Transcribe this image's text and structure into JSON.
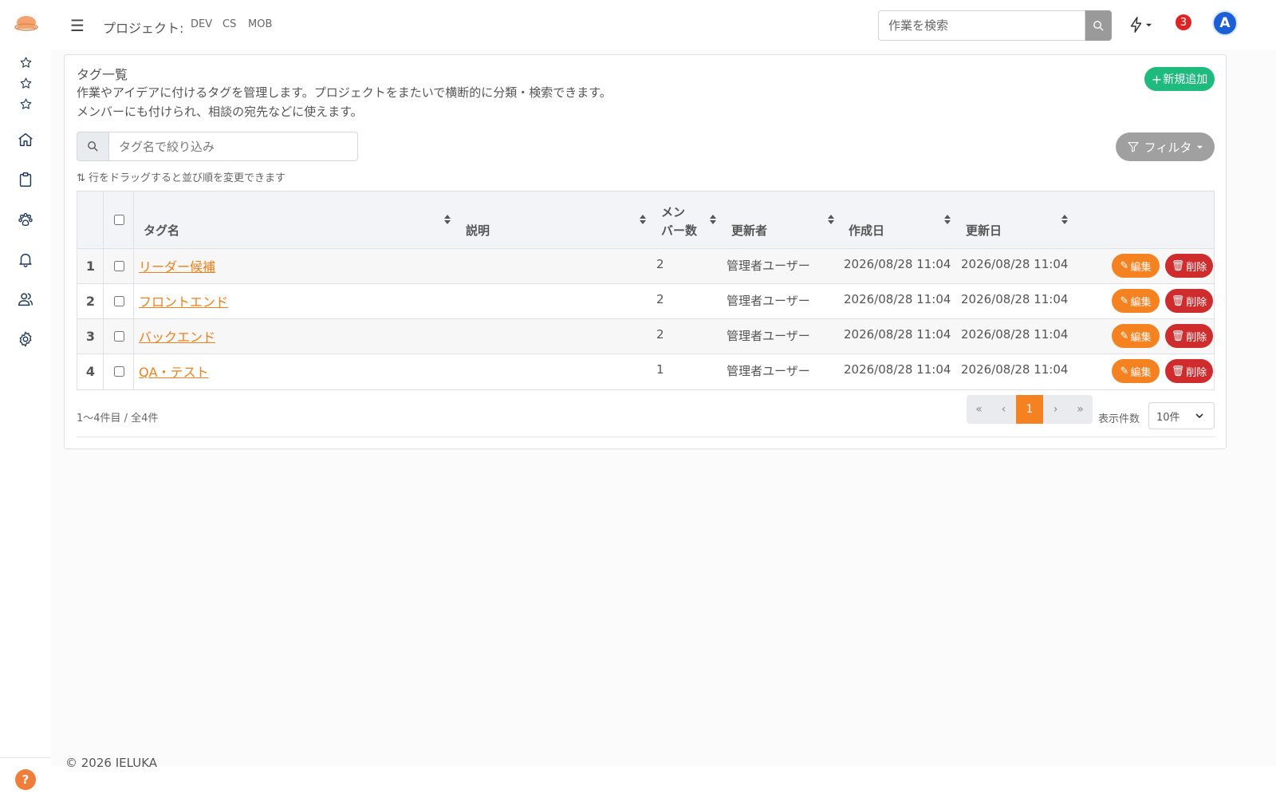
{
  "topbar": {
    "menu_icon": "☰",
    "project_label": "プロジェクト:",
    "projects": [
      "DEV",
      "CS",
      "MOB"
    ],
    "search_placeholder": "作業を検索",
    "notification_count": "3",
    "avatar_initial": "A"
  },
  "page": {
    "title": "タグ一覧",
    "description_lines": [
      "作業やアイデアに付けるタグを管理します。プロジェクトをまたいで横断的に分類・検索できます。",
      "メンバーにも付けられ、相談の宛先などに使えます。"
    ],
    "new_button_label": "新規追加",
    "filter_placeholder": "タグ名で絞り込み",
    "filter_button_label": "フィルタ",
    "drag_hint": "行をドラッグすると並び順を変更できます"
  },
  "table": {
    "headers": {
      "tag_name": "タグ名",
      "description": "説明",
      "members_line1": "メン",
      "members_line2": "バー数",
      "updated_by": "更新者",
      "created_at": "作成日",
      "updated_at": "更新日"
    },
    "rows": [
      {
        "num": "1",
        "tag": "リーダー候補",
        "description": "",
        "members": "2",
        "updated_by": "管理者ユーザー",
        "created_at": "2026/08/28 11:04",
        "updated_at": "2026/08/28 11:04"
      },
      {
        "num": "2",
        "tag": "フロントエンド",
        "description": "",
        "members": "2",
        "updated_by": "管理者ユーザー",
        "created_at": "2026/08/28 11:04",
        "updated_at": "2026/08/28 11:04"
      },
      {
        "num": "3",
        "tag": "バックエンド",
        "description": "",
        "members": "2",
        "updated_by": "管理者ユーザー",
        "created_at": "2026/08/28 11:04",
        "updated_at": "2026/08/28 11:04"
      },
      {
        "num": "4",
        "tag": "QA・テスト",
        "description": "",
        "members": "1",
        "updated_by": "管理者ユーザー",
        "created_at": "2026/08/28 11:04",
        "updated_at": "2026/08/28 11:04"
      }
    ],
    "edit_label": "編集",
    "delete_label": "削除"
  },
  "pagination": {
    "range_text": "1〜4件目 / 全4件",
    "first": "«",
    "prev": "‹",
    "current": "1",
    "next": "›",
    "last": "»",
    "per_page_label": "表示件数",
    "per_page_value": "10件"
  },
  "footer": {
    "copyright": "© 2026 IELUKA"
  },
  "colors": {
    "accent_orange": "#f58220",
    "danger_red": "#cf2d2d",
    "success_green": "#1fba7d",
    "avatar_blue": "#1a5fd6",
    "badge_red": "#dc2626"
  }
}
